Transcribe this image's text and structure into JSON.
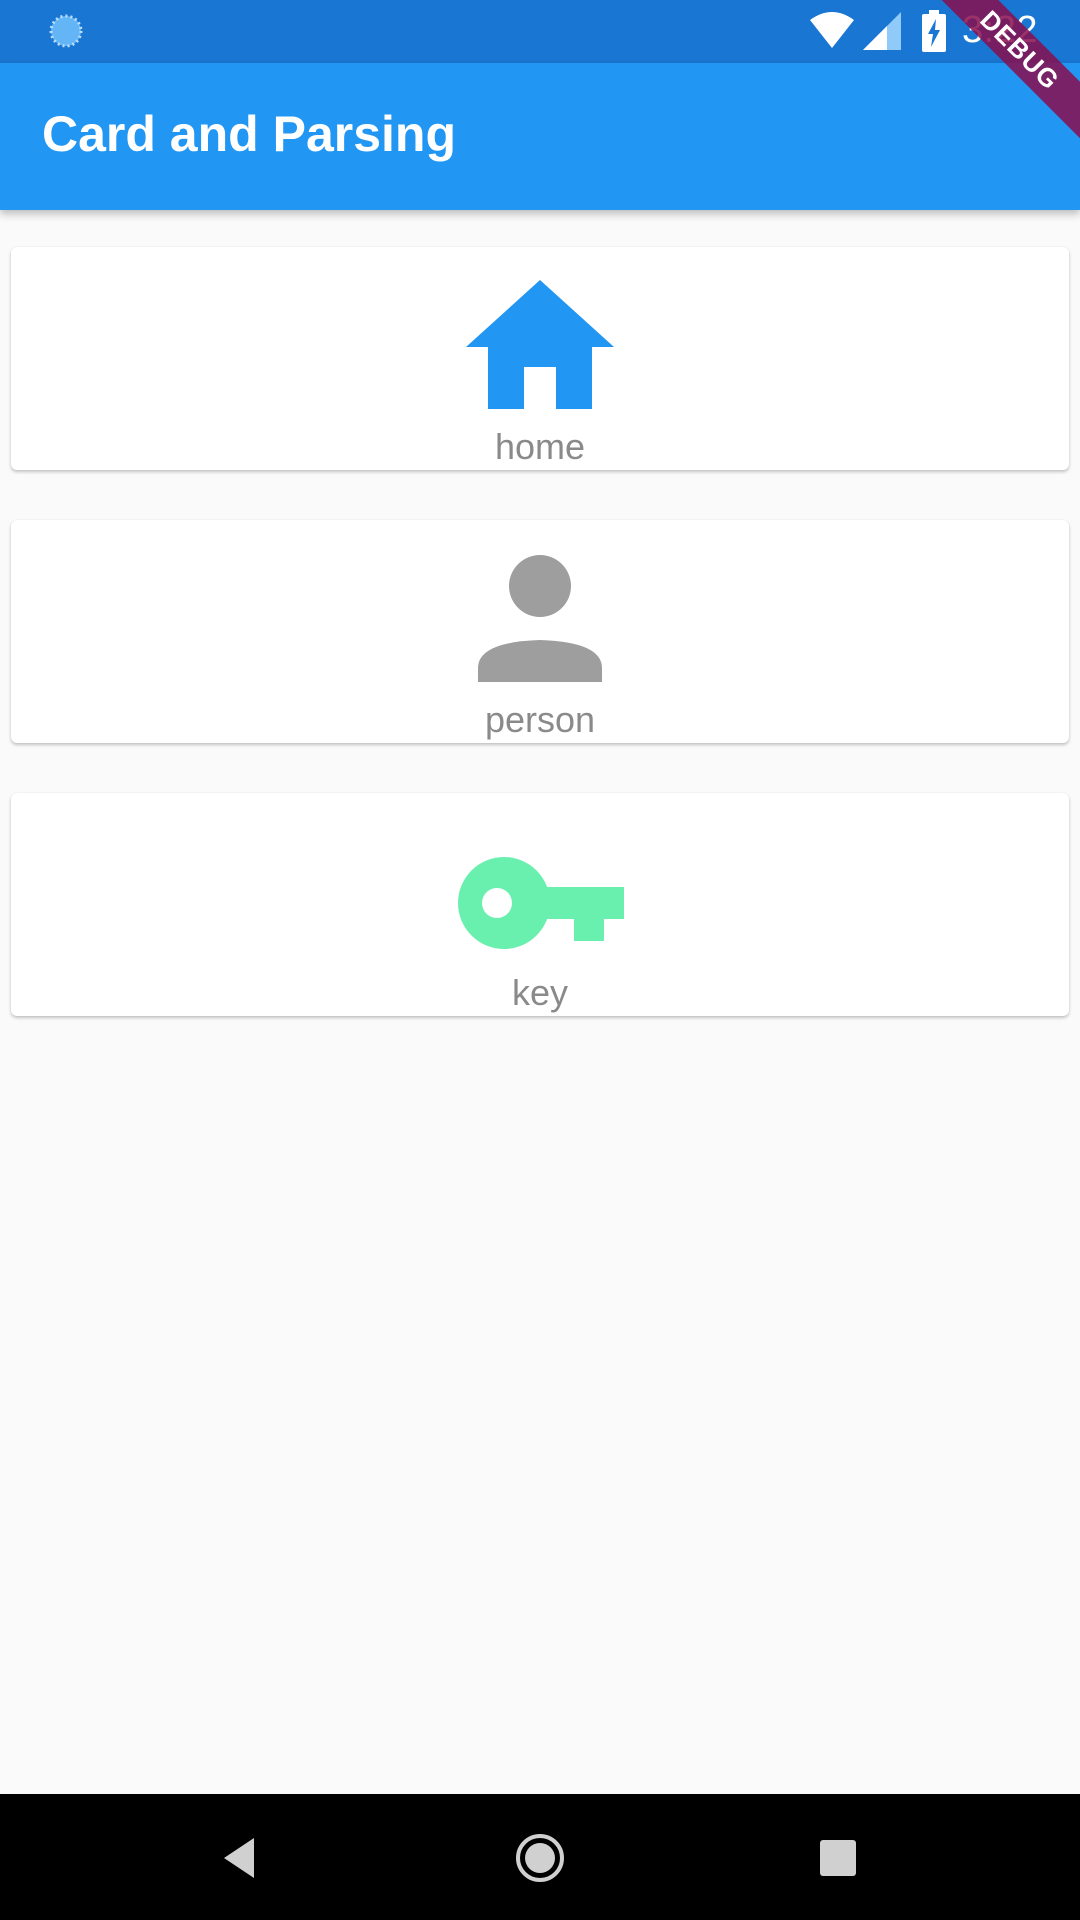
{
  "status_bar": {
    "time": "3:22",
    "icons": [
      "loading-icon",
      "wifi-icon",
      "signal-icon",
      "battery-charging-icon"
    ]
  },
  "app_bar": {
    "title": "Card and Parsing"
  },
  "debug_banner": {
    "label": "DEBUG"
  },
  "cards": [
    {
      "icon": "home-icon",
      "label": "home",
      "color": "#2196f3"
    },
    {
      "icon": "person-icon",
      "label": "person",
      "color": "#9e9e9e"
    },
    {
      "icon": "key-icon",
      "label": "key",
      "color": "#69f0ae"
    }
  ],
  "nav_bar": {
    "buttons": [
      "back-icon",
      "home-circle-icon",
      "recents-icon"
    ]
  },
  "colors": {
    "status_bar": "#1976d2",
    "app_bar": "#2196f3",
    "background": "#fafafa",
    "label_text": "#8a8a8a",
    "debug_ribbon": "#880e4f"
  }
}
